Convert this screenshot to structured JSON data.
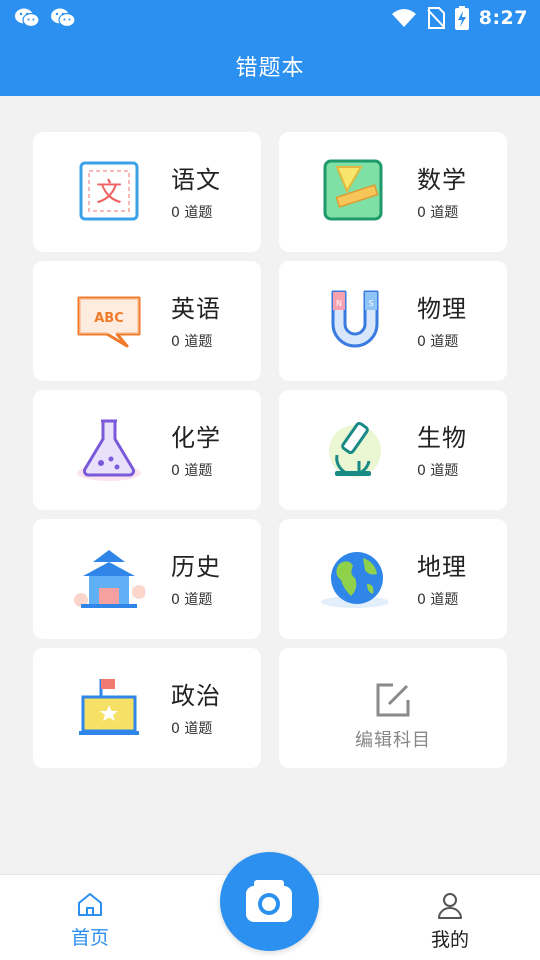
{
  "status_bar": {
    "time": "8:27"
  },
  "header": {
    "title": "错题本"
  },
  "subjects": [
    {
      "name": "语文",
      "count": "0 道题",
      "icon": "chinese-icon"
    },
    {
      "name": "数学",
      "count": "0 道题",
      "icon": "math-icon"
    },
    {
      "name": "英语",
      "count": "0 道题",
      "icon": "english-icon"
    },
    {
      "name": "物理",
      "count": "0 道题",
      "icon": "physics-icon"
    },
    {
      "name": "化学",
      "count": "0 道题",
      "icon": "chemistry-icon"
    },
    {
      "name": "生物",
      "count": "0 道题",
      "icon": "biology-icon"
    },
    {
      "name": "历史",
      "count": "0 道题",
      "icon": "history-icon"
    },
    {
      "name": "地理",
      "count": "0 道题",
      "icon": "geography-icon"
    },
    {
      "name": "政治",
      "count": "0 道题",
      "icon": "politics-icon"
    }
  ],
  "edit_subjects": {
    "label": "编辑科目",
    "icon": "edit-icon"
  },
  "bottom_nav": {
    "home_label": "首页",
    "mine_label": "我的",
    "camera_icon": "camera-icon"
  },
  "colors": {
    "primary": "#2b90ef",
    "background": "#f2f2f2"
  }
}
